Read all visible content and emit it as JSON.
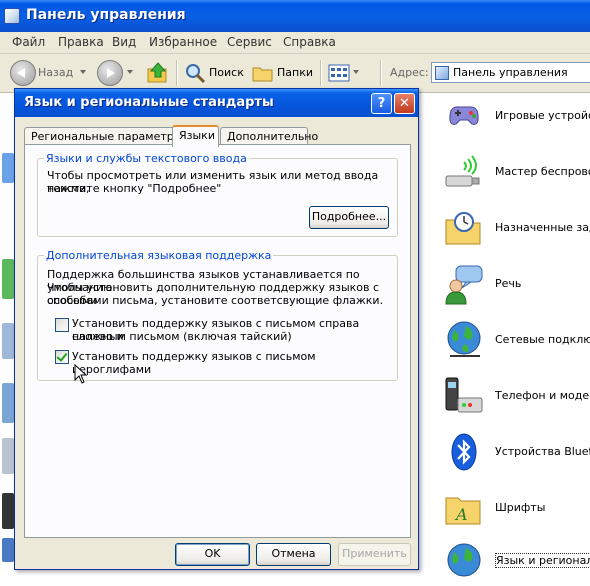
{
  "explorer": {
    "title": "Панель управления",
    "menu": [
      "Файл",
      "Правка",
      "Вид",
      "Избранное",
      "Сервис",
      "Справка"
    ],
    "toolbar": {
      "back": "Назад",
      "search": "Поиск",
      "folders": "Папки"
    },
    "address_label": "Адрес:",
    "address_value": "Панель управления"
  },
  "control_panel_items": [
    {
      "label": "Игровые устройст",
      "icon": "gamepad-icon"
    },
    {
      "label": "Мастер беспровод",
      "icon": "usb-wireless-icon"
    },
    {
      "label": "Назначенные зада",
      "icon": "scheduled-tasks-icon"
    },
    {
      "label": "Речь",
      "icon": "speech-icon"
    },
    {
      "label": "Сетевые подключ",
      "icon": "network-globe-icon"
    },
    {
      "label": "Телефон и модем",
      "icon": "phone-modem-icon"
    },
    {
      "label": "Устройства Blueto",
      "icon": "bluetooth-icon"
    },
    {
      "label": "Шрифты",
      "icon": "fonts-folder-icon"
    },
    {
      "label": "Язык и региональ",
      "icon": "regional-globe-icon"
    }
  ],
  "dialog": {
    "title": "Язык и региональные стандарты",
    "help_glyph": "?",
    "close_glyph": "✕",
    "tabs": [
      "Региональные параметры",
      "Языки",
      "Дополнительно"
    ],
    "active_tab": 1,
    "group1": {
      "title": "Языки и службы текстового ввода",
      "text_line1": "Чтобы просмотреть или изменить язык или метод ввода текста,",
      "text_line2": "нажмите кнопку \"Подробнее\"",
      "details_button": "Подробнее..."
    },
    "group2": {
      "title": "Дополнительная языковая поддержка",
      "text_line1": "Поддержка большинства языков устанавливается по умолчанию.",
      "text_line2": "Чтобы установить дополнительную поддержку языков с особыми",
      "text_line3": "способами письма, установите соответсвующие флажки.",
      "checkbox1_line1": "Установить поддержку языков с письмом справа налево и",
      "checkbox1_line2": "сложным письмом (включая тайский)",
      "checkbox1_checked": false,
      "checkbox2": "Установить поддержку языков с письмом иероглифами",
      "checkbox2_checked": true
    },
    "buttons": {
      "ok": "OK",
      "cancel": "Отмена",
      "apply": "Применить"
    }
  },
  "colors": {
    "xp_blue": "#0a5fe3",
    "dialog_bg": "#ece9d8",
    "group_title": "#0046d5"
  }
}
